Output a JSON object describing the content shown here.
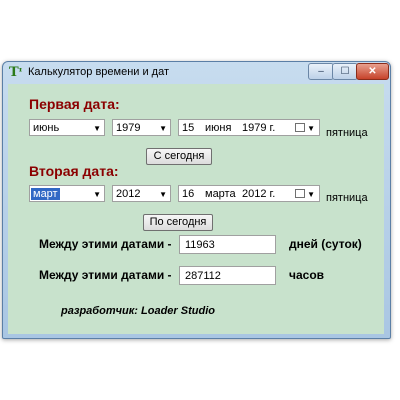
{
  "window": {
    "title": "Калькулятор времени и дат",
    "app_icon_glyph": "Tᶦ",
    "minimize_glyph": "–",
    "maximize_glyph": "☐",
    "close_glyph": "✕"
  },
  "first_date": {
    "label": "Первая дата:",
    "month": "июнь",
    "year": "1979",
    "picker_day": "15",
    "picker_month": "июня",
    "picker_year": "1979 г.",
    "weekday": "пятница",
    "button": "С сегодня"
  },
  "second_date": {
    "label": "Вторая дата:",
    "month": "март",
    "year": "2012",
    "picker_day": "16",
    "picker_month": "марта",
    "picker_year": "2012 г.",
    "weekday": "пятница",
    "button": "По сегодня"
  },
  "results": {
    "days_label": "Между этими датами -",
    "days_value": "11963",
    "days_unit": "дней (суток)",
    "hours_label": "Между этими датами -",
    "hours_value": "287112",
    "hours_unit": "часов"
  },
  "credit": "разработчик: Loader Studio",
  "icons": {
    "dropdown": "▼",
    "calendar": "calendar-icon"
  },
  "colors": {
    "section_label": "#8b0000",
    "client_bg": "#c8e2cc",
    "selection": "#3168c5"
  }
}
